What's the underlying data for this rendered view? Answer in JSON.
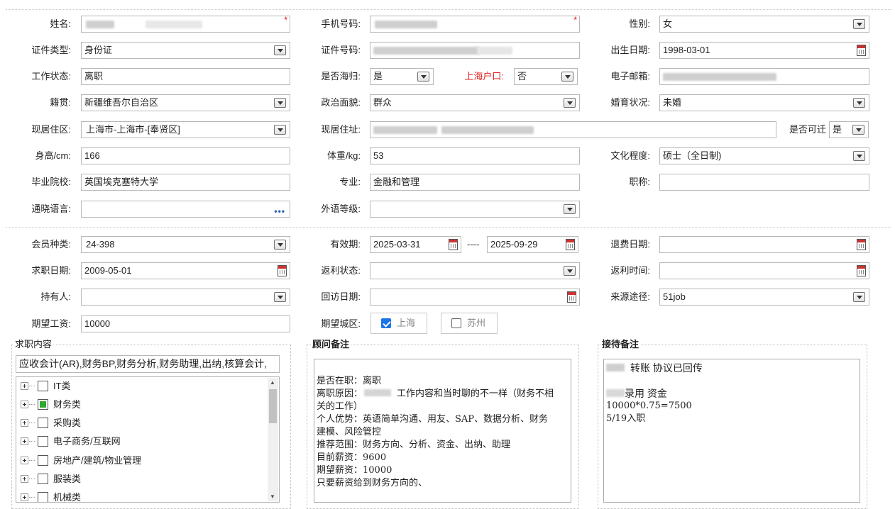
{
  "basic": {
    "name_label": "姓名:",
    "phone_label": "手机号码:",
    "gender_label": "性别:",
    "gender": "女",
    "id_type_label": "证件类型:",
    "id_type": "身份证",
    "id_no_label": "证件号码:",
    "birth_label": "出生日期:",
    "birth": "1998-03-01",
    "work_status_label": "工作状态:",
    "work_status": "离职",
    "returnee_label": "是否海归:",
    "returnee": "是",
    "shanghai_hukou_label": "上海户口:",
    "shanghai_hukou": "否",
    "email_label": "电子邮箱:",
    "native_label": "籍贯:",
    "native": "新疆维吾尔自治区",
    "political_label": "政治面貌:",
    "political": "群众",
    "marital_label": "婚育状况:",
    "marital": "未婚",
    "residence_area_label": "现居住区:",
    "residence_area": "上海市-上海市-[奉贤区]",
    "residence_addr_label": "现居住址:",
    "relocate_label": "是否可迁",
    "relocate": "是",
    "height_label": "身高/cm:",
    "height": "166",
    "weight_label": "体重/kg:",
    "weight": "53",
    "education_label": "文化程度:",
    "education": "硕士（全日制)",
    "school_label": "毕业院校:",
    "school": "英国埃克塞特大学",
    "major_label": "专业:",
    "major": "金融和管理",
    "title_label": "职称:",
    "title": "",
    "language_label": "通晓语言:",
    "language": "",
    "foreign_level_label": "外语等级:",
    "foreign_level": ""
  },
  "member": {
    "type_label": "会员种类:",
    "type": "24-398",
    "valid_label": "有效期:",
    "valid_from": "2025-03-31",
    "valid_sep": "----",
    "valid_to": "2025-09-29",
    "refund_date_label": "退费日期:",
    "refund_date": "",
    "jobseek_date_label": "求职日期:",
    "jobseek_date": "2009-05-01",
    "rebate_status_label": "返利状态:",
    "rebate_status": "",
    "rebate_time_label": "返利时间:",
    "rebate_time": "",
    "holder_label": "持有人:",
    "holder": "",
    "visit_date_label": "回访日期:",
    "visit_date": "",
    "source_label": "来源途径:",
    "source": "51job",
    "salary_label": "期望工资:",
    "salary": "10000",
    "city_label": "期望城区:",
    "cities": [
      {
        "label": "上海",
        "checked": true
      },
      {
        "label": "苏州",
        "checked": false
      }
    ]
  },
  "job_content": {
    "title": "求职内容",
    "selected": "应收会计(AR),财务BP,财务分析,财务助理,出纳,核算会计,",
    "tree": [
      {
        "label": "IT类",
        "state": "none"
      },
      {
        "label": "财务类",
        "state": "partial"
      },
      {
        "label": "采购类",
        "state": "none"
      },
      {
        "label": "电子商务/互联网",
        "state": "none"
      },
      {
        "label": "房地产/建筑/物业管理",
        "state": "none"
      },
      {
        "label": "服装类",
        "state": "none"
      },
      {
        "label": "机械类",
        "state": "none"
      }
    ]
  },
  "advisor_notes": {
    "title": "顾问备注",
    "lines": [
      "是否在职：离职",
      "离职原因：",
      "工作内容和当时聊的不一样（财务不相",
      "关的工作）",
      "个人优势：英语简单沟通、用友、SAP、数据分析、财务",
      "建模、风险管控",
      "推荐范围：财务方向、分析、资金、出纳、助理",
      "目前薪资：9600",
      "期望薪资：10000",
      "只要薪资给到财务方向的、"
    ]
  },
  "reception_notes": {
    "title": "接待备注",
    "lines": [
      "转账 协议已回传",
      "",
      "录用  资金",
      "10000*0.75=7500",
      "5/19入职"
    ]
  }
}
